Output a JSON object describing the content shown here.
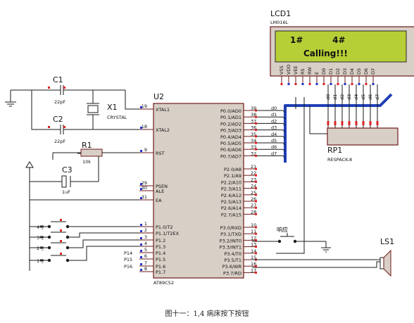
{
  "lcd": {
    "ref": "LCD1",
    "model": "LM016L",
    "line1": "1#          4#",
    "line2": "Calling!!!",
    "pins": [
      "VSS",
      "VDD",
      "VEE",
      "RS",
      "RW",
      "E",
      "D0",
      "D1",
      "D2",
      "D3",
      "D4",
      "D5",
      "D6",
      "D7"
    ]
  },
  "mcu": {
    "ref": "U2",
    "model": "AT89C52",
    "left_pins": [
      {
        "num": "19",
        "name": "XTAL1"
      },
      {
        "num": "18",
        "name": "XTAL2"
      },
      {
        "num": "9",
        "name": "RST"
      },
      {
        "num": "29",
        "name": "PSEN"
      },
      {
        "num": "30",
        "name": "ALE"
      },
      {
        "num": "31",
        "name": "EA"
      },
      {
        "num": "1",
        "name": "P1.0/T2"
      },
      {
        "num": "2",
        "name": "P1.1/T2EX"
      },
      {
        "num": "3",
        "name": "P1.2"
      },
      {
        "num": "4",
        "name": "P1.3"
      },
      {
        "num": "5",
        "name": "P1.4"
      },
      {
        "num": "6",
        "name": "P1.5"
      },
      {
        "num": "7",
        "name": "P1.6"
      },
      {
        "num": "8",
        "name": "P1.7"
      }
    ],
    "right_pins": [
      {
        "num": "39",
        "name": "P0.0/AD0"
      },
      {
        "num": "38",
        "name": "P0.1/AD1"
      },
      {
        "num": "37",
        "name": "P0.2/AD2"
      },
      {
        "num": "36",
        "name": "P0.3/AD3"
      },
      {
        "num": "35",
        "name": "P0.4/AD4"
      },
      {
        "num": "34",
        "name": "P0.5/AD5"
      },
      {
        "num": "33",
        "name": "P0.6/AD6"
      },
      {
        "num": "32",
        "name": "P0.7/AD7"
      },
      {
        "num": "21",
        "name": "P2.0/A8"
      },
      {
        "num": "22",
        "name": "P2.1/A9"
      },
      {
        "num": "23",
        "name": "P2.2/A10"
      },
      {
        "num": "24",
        "name": "P2.3/A11"
      },
      {
        "num": "25",
        "name": "P2.4/A12"
      },
      {
        "num": "26",
        "name": "P2.5/A13"
      },
      {
        "num": "27",
        "name": "P2.6/A14"
      },
      {
        "num": "28",
        "name": "P2.7/A15"
      },
      {
        "num": "10",
        "name": "P3.0/RXD"
      },
      {
        "num": "11",
        "name": "P3.1/TXD"
      },
      {
        "num": "12",
        "name": "P3.2/INT0"
      },
      {
        "num": "13",
        "name": "P3.3/INT1"
      },
      {
        "num": "14",
        "name": "P3.4/T0"
      },
      {
        "num": "15",
        "name": "P3.5/T1"
      },
      {
        "num": "16",
        "name": "P3.6/WR"
      },
      {
        "num": "17",
        "name": "P3.7/RD"
      }
    ]
  },
  "data_lines": [
    "d0",
    "d1",
    "d2",
    "d3",
    "d4",
    "d5",
    "d6",
    "d7"
  ],
  "components": {
    "c1": {
      "ref": "C1",
      "value": "22pF"
    },
    "c2": {
      "ref": "C2",
      "value": "22pF"
    },
    "x1": {
      "ref": "X1",
      "value": "CRYSTAL"
    },
    "r1": {
      "ref": "R1",
      "value": "10k"
    },
    "c3": {
      "ref": "C3",
      "value": "1uF"
    },
    "rp1": {
      "ref": "RP1",
      "value": "RESPACK-8"
    },
    "ls1": {
      "ref": "LS1"
    },
    "answer_btn": {
      "label": "响应"
    }
  },
  "buttons": [
    "4号",
    "3号",
    "2号",
    "1号"
  ],
  "port_labels": [
    "P14",
    "P15",
    "P16"
  ],
  "caption": "图十一：1,4 病床按下按钮"
}
